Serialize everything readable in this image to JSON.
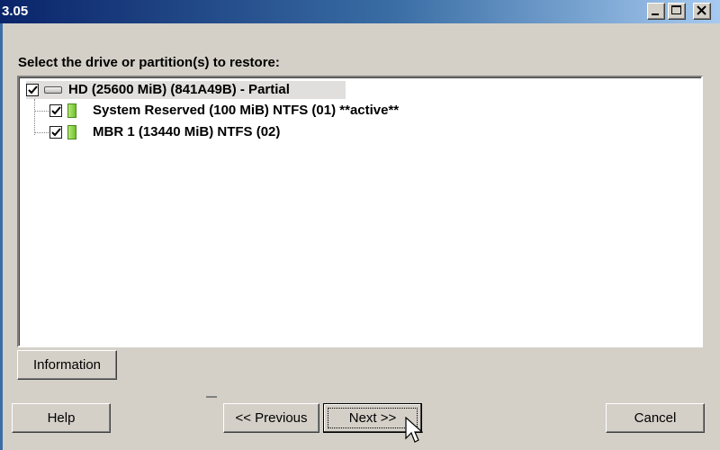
{
  "window": {
    "title_fragment": "3.05"
  },
  "title_buttons": {
    "minimize_icon": "minimize-icon",
    "maximize_icon": "maximize-icon",
    "close_icon": "close-icon"
  },
  "prompt": "Select the drive or partition(s) to restore:",
  "tree": {
    "root": {
      "label": "HD (25600 MiB) (841A49B) - Partial",
      "checked": true,
      "icon": "hard-drive-icon"
    },
    "children": [
      {
        "label": "System Reserved (100 MiB) NTFS (01) **active**",
        "checked": true,
        "icon": "partition-icon"
      },
      {
        "label": "MBR 1 (13440 MiB) NTFS (02)",
        "checked": true,
        "icon": "partition-icon"
      }
    ]
  },
  "buttons": {
    "information": "Information",
    "help": "Help",
    "previous": "<< Previous",
    "next": "Next >>",
    "cancel": "Cancel"
  },
  "colors": {
    "face": "#d4d0c8",
    "title_gradient_start": "#0a246a",
    "title_gradient_end": "#a6caf0",
    "partition_green": "#6fc22c"
  }
}
